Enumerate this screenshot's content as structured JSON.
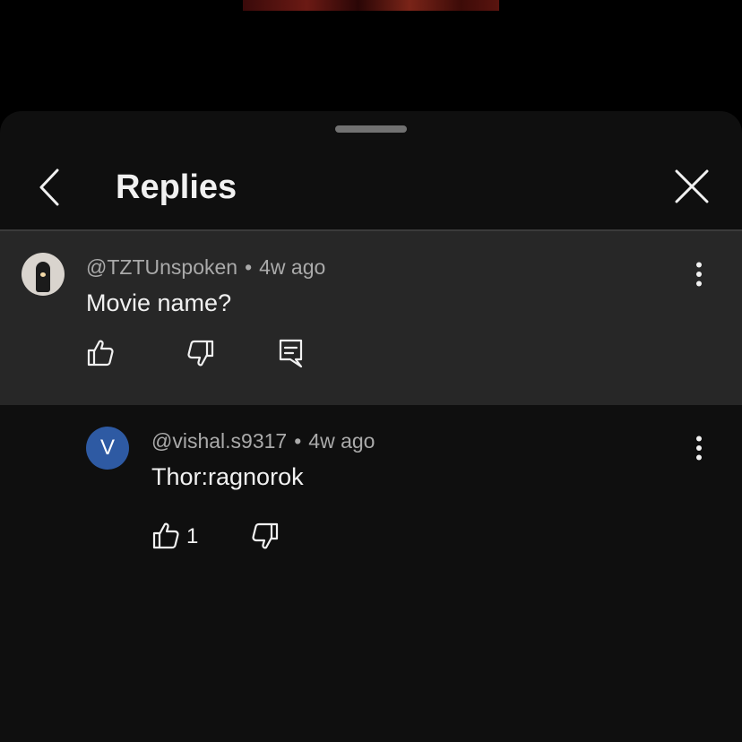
{
  "header": {
    "title": "Replies"
  },
  "parent_comment": {
    "author": "@TZTUnspoken",
    "separator": "•",
    "time": "4w ago",
    "text": "Movie name?"
  },
  "replies": [
    {
      "avatar_letter": "V",
      "avatar_color": "#2e5aa3",
      "author": "@vishal.s9317",
      "separator": "•",
      "time": "4w ago",
      "text": "Thor:ragnorok",
      "like_count": "1"
    }
  ],
  "colors": {
    "background": "#000000",
    "sheet": "#0f0f0f",
    "highlight_row": "#272727",
    "primary_text": "#f1f1f1",
    "secondary_text": "#aaaaaa"
  }
}
